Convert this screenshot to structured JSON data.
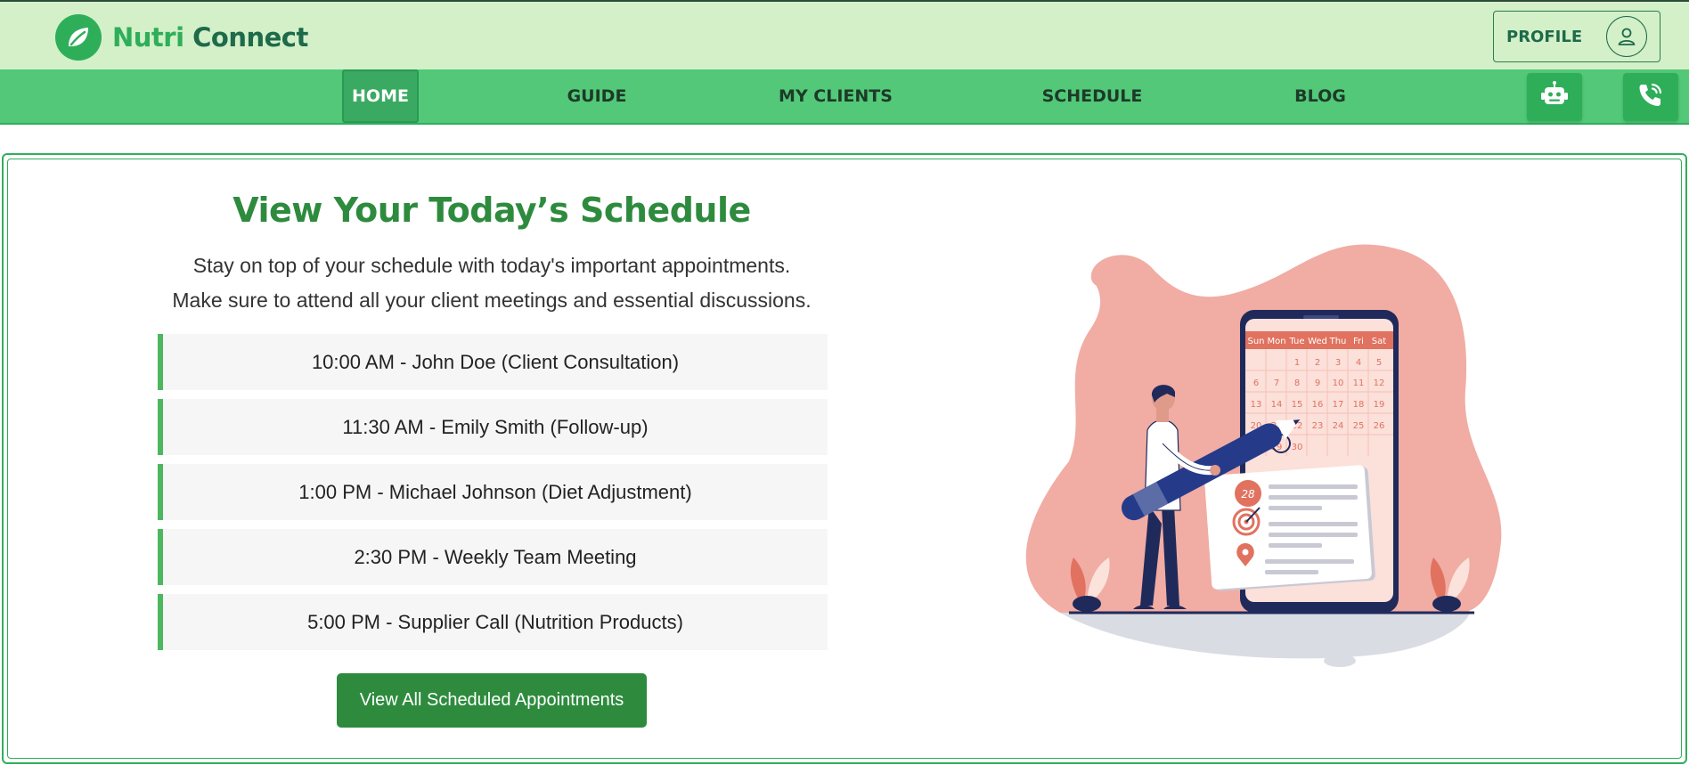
{
  "brand": {
    "part1": "Nutri",
    "part2": "Connect",
    "logo_icon": "leaf-icon"
  },
  "header": {
    "profile_label": "PROFILE",
    "profile_icon": "user-icon"
  },
  "nav": {
    "items": [
      {
        "label": "HOME",
        "active": true
      },
      {
        "label": "GUIDE",
        "active": false
      },
      {
        "label": "MY CLIENTS",
        "active": false
      },
      {
        "label": "SCHEDULE",
        "active": false
      },
      {
        "label": "BLOG",
        "active": false
      }
    ],
    "chatbot_icon": "robot-icon",
    "call_icon": "phone-call-icon"
  },
  "main": {
    "title": "View Your Today’s Schedule",
    "subtitle_line1": "Stay on top of your schedule with today's important appointments.",
    "subtitle_line2": "Make sure to attend all your client meetings and essential discussions.",
    "appointments": [
      "10:00 AM - John Doe (Client Consultation)",
      "11:30 AM - Emily Smith (Follow-up)",
      "1:00 PM - Michael Johnson (Diet Adjustment)",
      "2:30 PM - Weekly Team Meeting",
      "5:00 PM - Supplier Call (Nutrition Products)"
    ],
    "cta_label": "View All Scheduled Appointments"
  },
  "illustration": {
    "weekdays": [
      "Sun",
      "Mon",
      "Tue",
      "Wed",
      "Thu",
      "Fri",
      "Sat"
    ],
    "calendar_rows": [
      [
        "",
        "",
        "1",
        "2",
        "3",
        "4",
        "5"
      ],
      [
        "6",
        "7",
        "8",
        "9",
        "10",
        "11",
        "12"
      ],
      [
        "13",
        "14",
        "15",
        "16",
        "17",
        "18",
        "19"
      ],
      [
        "20",
        "21",
        "22",
        "23",
        "24",
        "25",
        "26"
      ],
      [
        "28",
        "29",
        "30",
        "",
        "",
        "",
        ""
      ]
    ],
    "badge_day": "28"
  },
  "colors": {
    "header_bg": "#d3f0c8",
    "nav_bg": "#52c878",
    "accent": "#2e8b3e",
    "brand_green": "#2fae5a",
    "illustration_blob": "#f1aca4"
  }
}
